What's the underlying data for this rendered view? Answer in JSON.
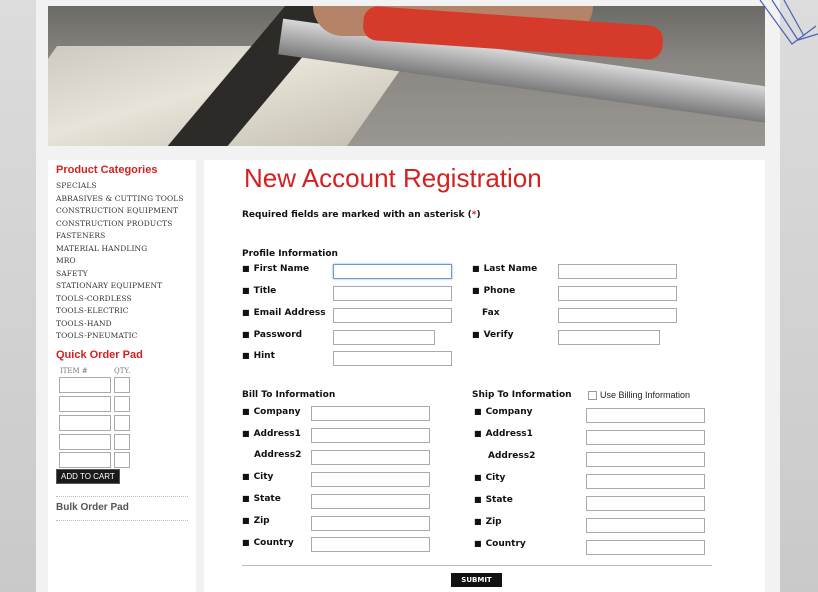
{
  "sidebar": {
    "categories_title": "Product Categories",
    "categories": [
      "SPECIALS",
      "ABRASIVES & CUTTING TOOLS",
      "CONSTRUCTION EQUIPMENT",
      "CONSTRUCTION PRODUCTS",
      "FASTENERS",
      "MATERIAL HANDLING",
      "MRO",
      "SAFETY",
      "STATIONARY EQUIPMENT",
      "TOOLS-CORDLESS",
      "TOOLS-ELECTRIC",
      "TOOLS-HAND",
      "TOOLS-PNEUMATIC"
    ],
    "quick_order_title": "Quick Order Pad",
    "item_header": "ITEM #",
    "qty_header": "QTY.",
    "add_to_cart": "ADD TO CART",
    "bulk_order": "Bulk Order Pad"
  },
  "main": {
    "title": "New Account Registration",
    "required_note": "Required fields are marked with an asterisk (",
    "required_star": "*",
    "required_close": ")",
    "profile": {
      "heading": "Profile Information",
      "first_name": "First Name",
      "last_name": "Last Name",
      "title": "Title",
      "phone": "Phone",
      "email": "Email Address",
      "fax": "Fax",
      "password": "Password",
      "verify": "Verify",
      "hint": "Hint"
    },
    "bill": {
      "heading": "Bill To Information",
      "company": "Company",
      "address1": "Address1",
      "address2": "Address2",
      "city": "City",
      "state": "State",
      "zip": "Zip",
      "country": "Country"
    },
    "ship": {
      "heading": "Ship To Information",
      "use_billing": "Use Billing Information",
      "company": "Company",
      "address1": "Address1",
      "address2": "Address2",
      "city": "City",
      "state": "State",
      "zip": "Zip",
      "country": "Country"
    },
    "submit": "SUBMIT"
  },
  "colors": {
    "accent_red": "#d42020",
    "focus_blue": "#6b9bd1"
  }
}
